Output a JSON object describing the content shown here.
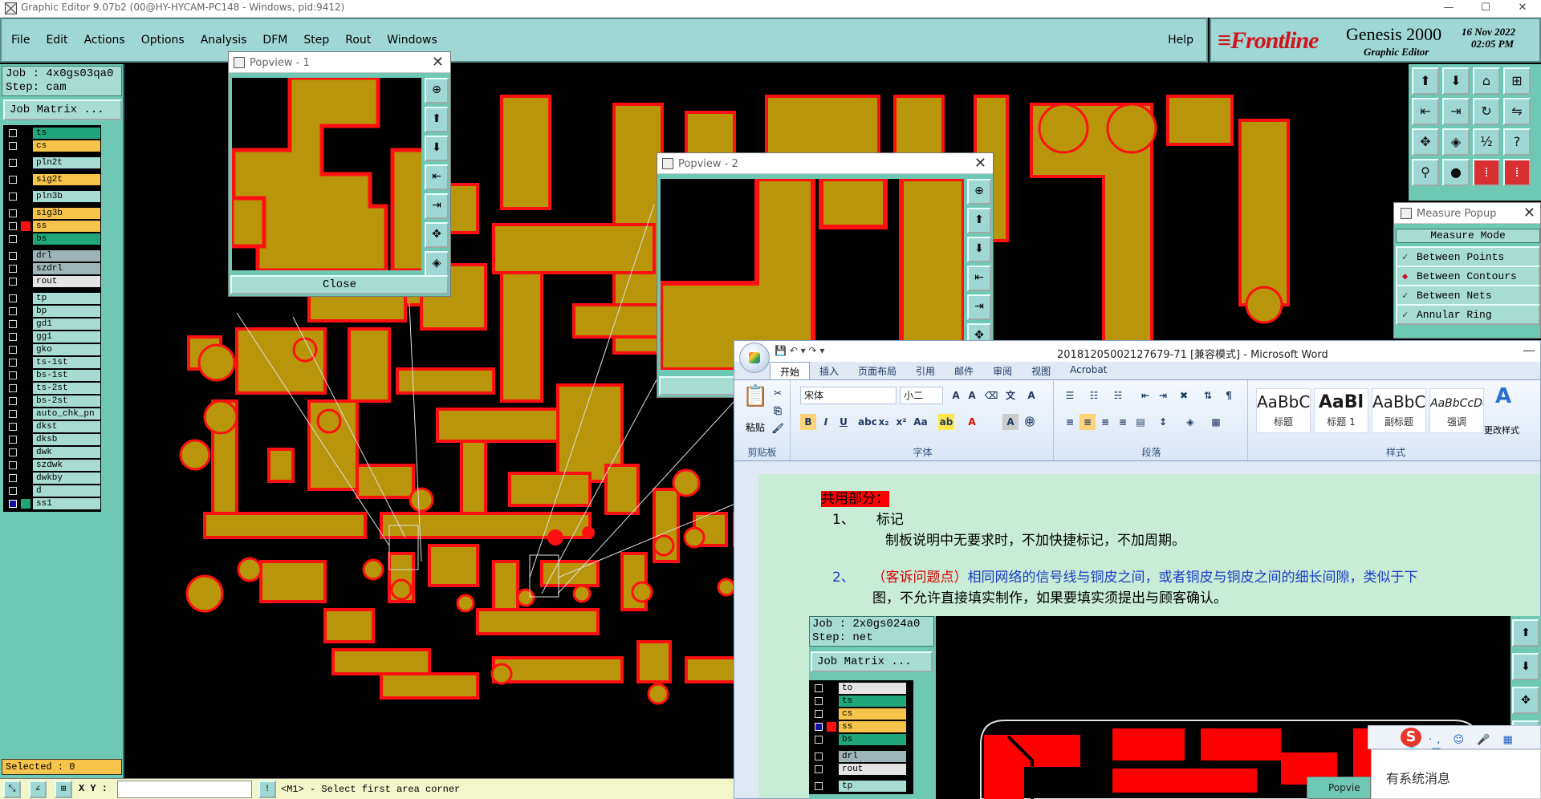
{
  "window": {
    "title": "Graphic Editor 9.07b2 (00@HY-HYCAM-PC148 - Windows, pid:9412)",
    "min": "—",
    "max": "☐",
    "close": "✕"
  },
  "menu": {
    "items": [
      "File",
      "Edit",
      "Actions",
      "Options",
      "Analysis",
      "DFM",
      "Step",
      "Rout",
      "Windows"
    ],
    "help": "Help"
  },
  "brand": {
    "logo_f": "F",
    "logo_rest": "Frontline",
    "product": "Genesis 2000",
    "subtitle": "Graphic Editor",
    "date": "16 Nov 2022",
    "time": "02:05 PM"
  },
  "job": {
    "job_line": "Job : 4x0gs03qa0",
    "step_line": "Step: cam",
    "matrix_btn": "Job Matrix ...",
    "selected": "Selected : 0"
  },
  "layers": [
    {
      "name": "ts",
      "color": "#1fa67a",
      "swatch": "#000",
      "gap": false,
      "sel": false
    },
    {
      "name": "cs",
      "color": "#f6c44a",
      "swatch": "#000",
      "gap": false,
      "sel": false
    },
    {
      "name": "pln2t",
      "color": "#a7dcd3",
      "swatch": "#000",
      "gap": true,
      "sel": false
    },
    {
      "name": "sig2t",
      "color": "#f6c44a",
      "swatch": "#000",
      "gap": true,
      "sel": false
    },
    {
      "name": "pln3b",
      "color": "#a7dcd3",
      "swatch": "#000",
      "gap": true,
      "sel": false
    },
    {
      "name": "sig3b",
      "color": "#f6c44a",
      "swatch": "#000",
      "gap": true,
      "sel": false
    },
    {
      "name": "ss",
      "color": "#f6c44a",
      "swatch": "#ff1010",
      "gap": false,
      "sel": false
    },
    {
      "name": "bs",
      "color": "#1fa67a",
      "swatch": "#000",
      "gap": false,
      "sel": false
    },
    {
      "name": "drl",
      "color": "#9fb4b8",
      "swatch": "#000",
      "gap": true,
      "sel": false
    },
    {
      "name": "szdrl",
      "color": "#9fb4b8",
      "swatch": "#000",
      "gap": false,
      "sel": false
    },
    {
      "name": "rout",
      "color": "#e4e4e4",
      "swatch": "#000",
      "gap": false,
      "sel": false
    },
    {
      "name": "tp",
      "color": "#a7dcd3",
      "swatch": "#000",
      "gap": true,
      "sel": false
    },
    {
      "name": "bp",
      "color": "#a7dcd3",
      "swatch": "#000",
      "gap": false,
      "sel": false
    },
    {
      "name": "gd1",
      "color": "#a7dcd3",
      "swatch": "#000",
      "gap": false,
      "sel": false
    },
    {
      "name": "gg1",
      "color": "#a7dcd3",
      "swatch": "#000",
      "gap": false,
      "sel": false
    },
    {
      "name": "gko",
      "color": "#a7dcd3",
      "swatch": "#000",
      "gap": false,
      "sel": false
    },
    {
      "name": "ts-1st",
      "color": "#a7dcd3",
      "swatch": "#000",
      "gap": false,
      "sel": false
    },
    {
      "name": "bs-1st",
      "color": "#a7dcd3",
      "swatch": "#000",
      "gap": false,
      "sel": false
    },
    {
      "name": "ts-2st",
      "color": "#a7dcd3",
      "swatch": "#000",
      "gap": false,
      "sel": false
    },
    {
      "name": "bs-2st",
      "color": "#a7dcd3",
      "swatch": "#000",
      "gap": false,
      "sel": false
    },
    {
      "name": "auto_chk_pn",
      "color": "#a7dcd3",
      "swatch": "#000",
      "gap": false,
      "sel": false
    },
    {
      "name": "dkst",
      "color": "#a7dcd3",
      "swatch": "#000",
      "gap": false,
      "sel": false
    },
    {
      "name": "dksb",
      "color": "#a7dcd3",
      "swatch": "#000",
      "gap": false,
      "sel": false
    },
    {
      "name": "dwk",
      "color": "#a7dcd3",
      "swatch": "#000",
      "gap": false,
      "sel": false
    },
    {
      "name": "szdwk",
      "color": "#a7dcd3",
      "swatch": "#000",
      "gap": false,
      "sel": false
    },
    {
      "name": "dwkby",
      "color": "#a7dcd3",
      "swatch": "#000",
      "gap": false,
      "sel": false
    },
    {
      "name": "d",
      "color": "#a7dcd3",
      "swatch": "#000",
      "gap": false,
      "sel": false
    },
    {
      "name": "ss1",
      "color": "#a7dcd3",
      "swatch": "#1fa67a",
      "gap": false,
      "sel": true
    }
  ],
  "popview1": {
    "title": "Popview - 1",
    "close_label": "Close"
  },
  "popview2": {
    "title": "Popview - 2"
  },
  "measure": {
    "title": "Measure Popup",
    "mode_label": "Measure Mode",
    "options": [
      {
        "label": "Between Points",
        "active": false
      },
      {
        "label": "Between Contours",
        "active": true
      },
      {
        "label": "Between Nets",
        "active": false
      },
      {
        "label": "Annular Ring",
        "active": false
      }
    ]
  },
  "word": {
    "title": "20181205002127679-71 [兼容模式] - Microsoft Word",
    "tabs": [
      "开始",
      "插入",
      "页面布局",
      "引用",
      "邮件",
      "审阅",
      "视图",
      "Acrobat"
    ],
    "font_name": "宋体",
    "font_size": "小二",
    "groups": {
      "clipboard": "剪贴板",
      "font": "字体",
      "paragraph": "段落",
      "styles": "样式"
    },
    "paste": "粘贴",
    "styles": [
      {
        "preview": "AaBbC",
        "name": "标题"
      },
      {
        "preview": "AaBl",
        "name": "标题 1"
      },
      {
        "preview": "AaBbC",
        "name": "副标题"
      },
      {
        "preview": "AaBbCcDc",
        "name": "强调"
      }
    ],
    "change_styles": "更改样式",
    "heading": "共用部分：",
    "item1_num": "1、",
    "item1_label": "标记",
    "item1_text": "制板说明中无要求时，不加快捷标记，不加周期。",
    "item2_num": "2、",
    "item2_red": "（客诉问题点）",
    "item2_blue1": "相同网络的信号线与铜皮之间，或者铜皮与铜皮之间的细长间隙，类似于下",
    "item2_blue2": "图，不允许直接填实制作，如果要填实须提出与顾客确认。"
  },
  "embed": {
    "job_line": "Job : 2x0gs024a0",
    "step_line": "Step: net",
    "matrix_btn": "Job Matrix ...",
    "layers": [
      {
        "name": "to",
        "color": "#e4e4e4",
        "swatch": "#000",
        "gap": false,
        "sel": false
      },
      {
        "name": "ts",
        "color": "#1fa67a",
        "swatch": "#000",
        "gap": false,
        "sel": false
      },
      {
        "name": "cs",
        "color": "#f6c44a",
        "swatch": "#000",
        "gap": false,
        "sel": false
      },
      {
        "name": "ss",
        "color": "#f6c44a",
        "swatch": "#ff1010",
        "gap": false,
        "sel": true
      },
      {
        "name": "bs",
        "color": "#1fa67a",
        "swatch": "#000",
        "gap": false,
        "sel": false
      },
      {
        "name": "drl",
        "color": "#9fb4b8",
        "swatch": "#000",
        "gap": true,
        "sel": false
      },
      {
        "name": "rout",
        "color": "#e4e4e4",
        "swatch": "#000",
        "gap": false,
        "sel": false
      },
      {
        "name": "tp",
        "color": "#a7dcd3",
        "swatch": "#000",
        "gap": true,
        "sel": false
      }
    ]
  },
  "ime": {
    "label": "中 ·, ☺ 🎤 ▦ 👕 ▩",
    "message": "有系统消息",
    "popview_mini": "Popvie"
  },
  "status": {
    "xy_label": "X Y :",
    "coord": "",
    "message": "<M1> - Select first area corner"
  }
}
